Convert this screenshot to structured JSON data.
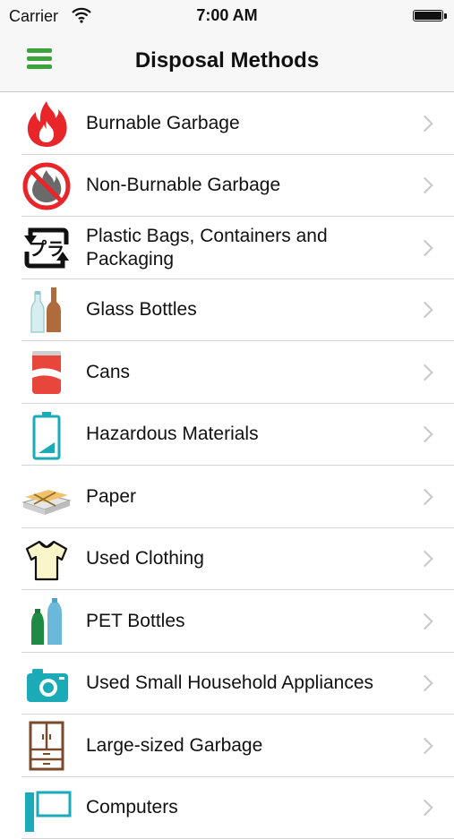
{
  "status_bar": {
    "carrier": "Carrier",
    "time": "7:00 AM"
  },
  "nav": {
    "title": "Disposal Methods"
  },
  "categories": [
    {
      "label": "Burnable Garbage",
      "icon": "fire-icon"
    },
    {
      "label": "Non-Burnable Garbage",
      "icon": "no-fire-icon"
    },
    {
      "label": "Plastic Bags, Containers and Packaging",
      "icon": "plastic-recycle-icon"
    },
    {
      "label": "Glass Bottles",
      "icon": "glass-bottles-icon"
    },
    {
      "label": "Cans",
      "icon": "can-icon"
    },
    {
      "label": "Hazardous Materials",
      "icon": "battery-icon"
    },
    {
      "label": "Paper",
      "icon": "paper-bundle-icon"
    },
    {
      "label": "Used Clothing",
      "icon": "shirt-icon"
    },
    {
      "label": "PET Bottles",
      "icon": "pet-bottles-icon"
    },
    {
      "label": "Used Small Household Appliances",
      "icon": "camera-icon"
    },
    {
      "label": "Large-sized Garbage",
      "icon": "cabinet-icon"
    },
    {
      "label": "Computers",
      "icon": "computer-icon"
    }
  ],
  "colors": {
    "accent": "#3da43d",
    "chevron": "#c7c7cc",
    "separator": "#d4d4d4"
  }
}
